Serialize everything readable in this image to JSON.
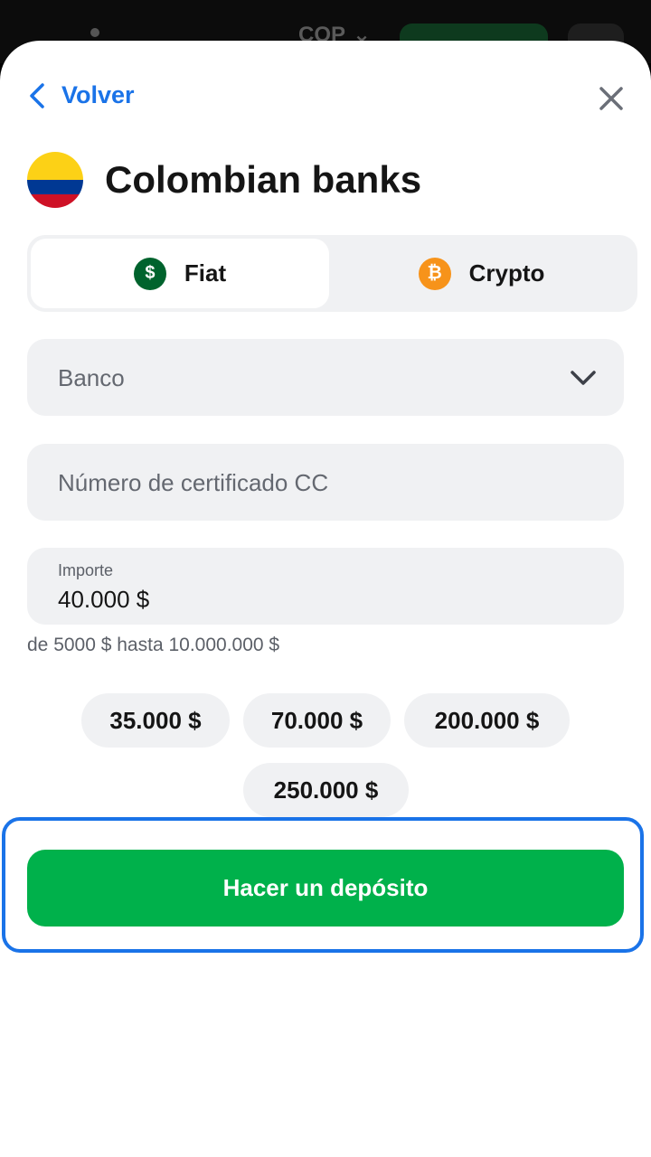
{
  "topbar": {
    "currency": "COP"
  },
  "header": {
    "back_label": "Volver"
  },
  "title": "Colombian banks",
  "tabs": [
    {
      "label": "Fiat",
      "icon": "dollar-icon",
      "active": true
    },
    {
      "label": "Crypto",
      "icon": "bitcoin-icon",
      "active": false
    }
  ],
  "form": {
    "bank_placeholder": "Banco",
    "certificate_placeholder": "Número de certificado CC",
    "amount_label": "Importe",
    "amount_value": "40.000 $",
    "limits_hint": "de 5000 $ hasta 10.000.000 $"
  },
  "presets": [
    "35.000 $",
    "70.000 $",
    "200.000 $",
    "250.000 $"
  ],
  "cta_label": "Hacer un depósito",
  "colors": {
    "accent_blue": "#1a73e8",
    "cta_green": "#00b14b",
    "fiat_green": "#00632d",
    "bitcoin_orange": "#f7931a"
  }
}
